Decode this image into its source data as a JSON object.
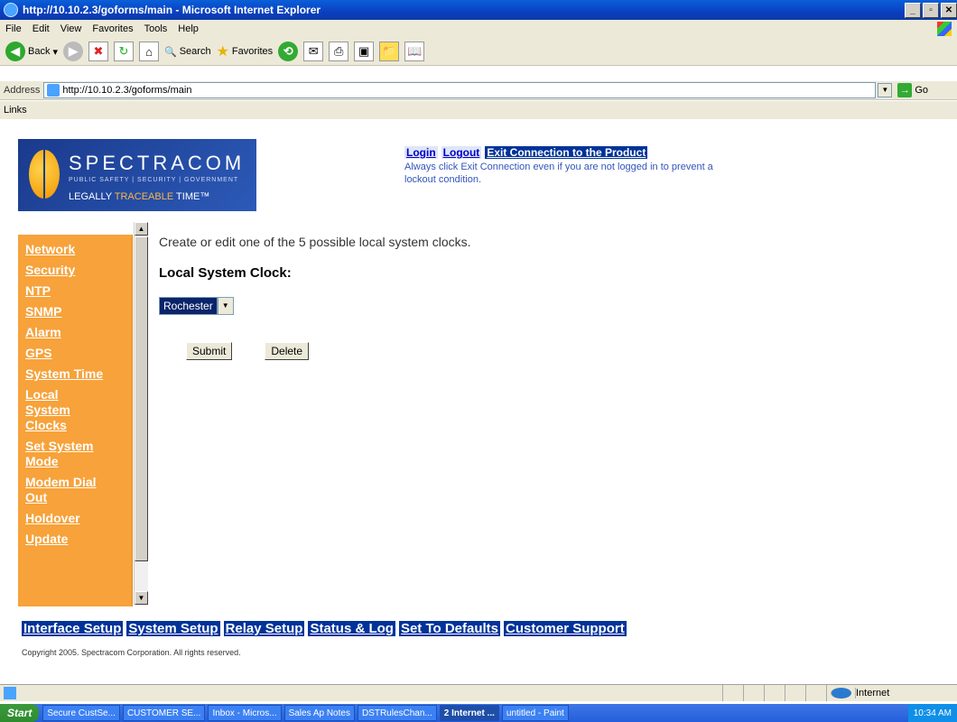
{
  "window": {
    "title": "http://10.10.2.3/goforms/main - Microsoft Internet Explorer"
  },
  "menu": [
    "File",
    "Edit",
    "View",
    "Favorites",
    "Tools",
    "Help"
  ],
  "toolbar": {
    "back": "Back",
    "search": "Search",
    "favorites": "Favorites"
  },
  "address": {
    "label": "Address",
    "url": "http://10.10.2.3/goforms/main",
    "go": "Go"
  },
  "links_label": "Links",
  "logo": {
    "word": "SPECTRACOM",
    "sub": "PUBLIC SAFETY | SECURITY | GOVERNMENT",
    "tag_a": "LEGALLY ",
    "tag_b": "TRACEABLE",
    "tag_c": " TIME™"
  },
  "topnav": {
    "login": "Login",
    "logout": "Logout",
    "exit": "Exit Connection to the Product",
    "note": "Always click Exit Connection even if you are not logged in to prevent a lockout condition."
  },
  "sidebar": [
    "Network",
    "Security",
    "NTP",
    "SNMP",
    "Alarm",
    "GPS",
    "System Time",
    "Local System Clocks",
    "Set System Mode",
    "Modem Dial Out",
    "Holdover",
    "Update"
  ],
  "main": {
    "intro": "Create or edit one of the 5 possible local system clocks.",
    "header": "Local System Clock:",
    "select_value": "Rochester",
    "submit": "Submit",
    "delete": "Delete"
  },
  "bottomnav": [
    "Interface Setup",
    "System Setup",
    "Relay Setup",
    "Status & Log",
    "Set To Defaults",
    "Customer Support"
  ],
  "copyright": "Copyright 2005. Spectracom Corporation. All rights reserved.",
  "status": {
    "zone": "Internet"
  },
  "taskbar": {
    "start": "Start",
    "tasks": [
      "Secure CustSe...",
      "CUSTOMER SE...",
      "Inbox - Micros...",
      "Sales Ap Notes",
      "DSTRulesChan...",
      "2 Internet ...",
      "untitled - Paint"
    ],
    "clock": "10:34 AM"
  }
}
